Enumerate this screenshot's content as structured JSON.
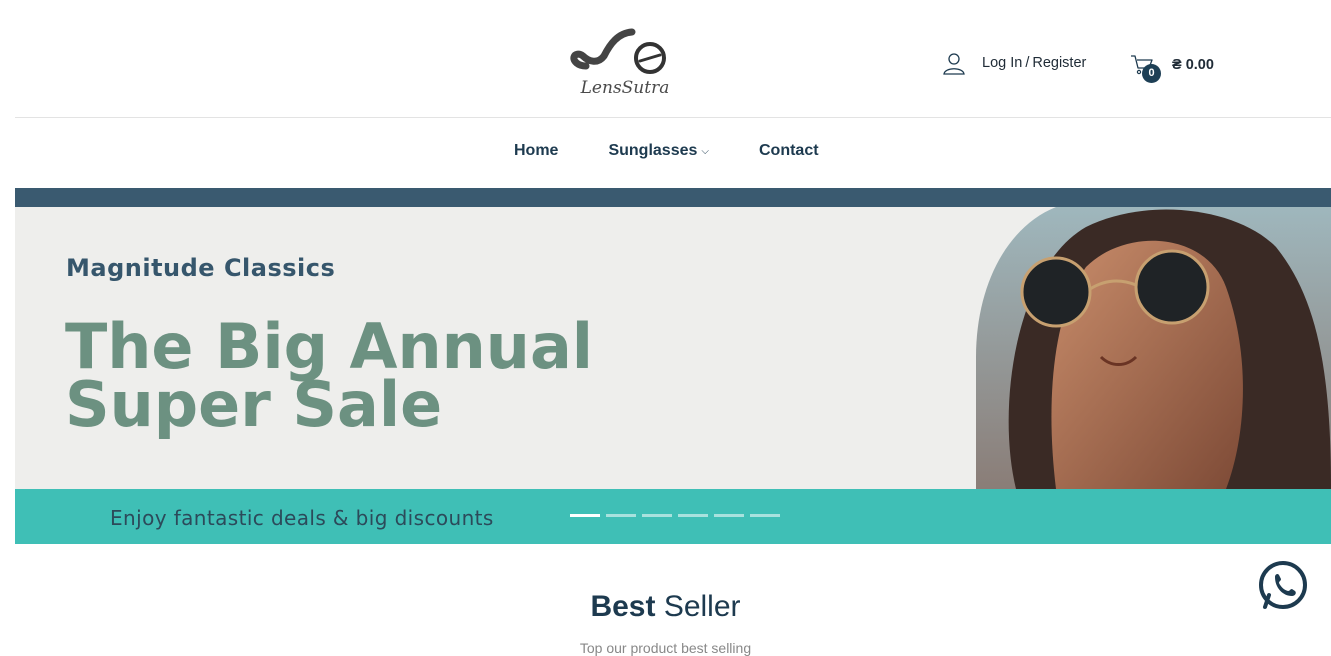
{
  "header": {
    "logo_text": "LensSutra",
    "account": {
      "icon": "user-icon",
      "login_label": "Log In",
      "separator": "/",
      "register_label": "Register"
    },
    "cart": {
      "icon": "cart-icon",
      "count": "0",
      "total": "₴ 0.00"
    }
  },
  "nav": {
    "items": [
      {
        "label": "Home"
      },
      {
        "label": "Sunglasses",
        "dropdown": true
      },
      {
        "label": "Contact"
      }
    ]
  },
  "banner": {
    "eyebrow": "Magnitude Classics",
    "headline_line1": "The Big Annual",
    "headline_line2": "Super Sale",
    "tagline": "Enjoy fantastic deals & big discounts",
    "slides": 6,
    "active_slide": 1,
    "colors": {
      "strip": "#3a5a70",
      "band": "#3fbfb6",
      "headline": "#6c9181"
    }
  },
  "best_seller": {
    "title_strong": "Best",
    "title_rest": " Seller",
    "subtitle": "Top our product best selling"
  },
  "floating": {
    "icon": "whatsapp-icon"
  }
}
